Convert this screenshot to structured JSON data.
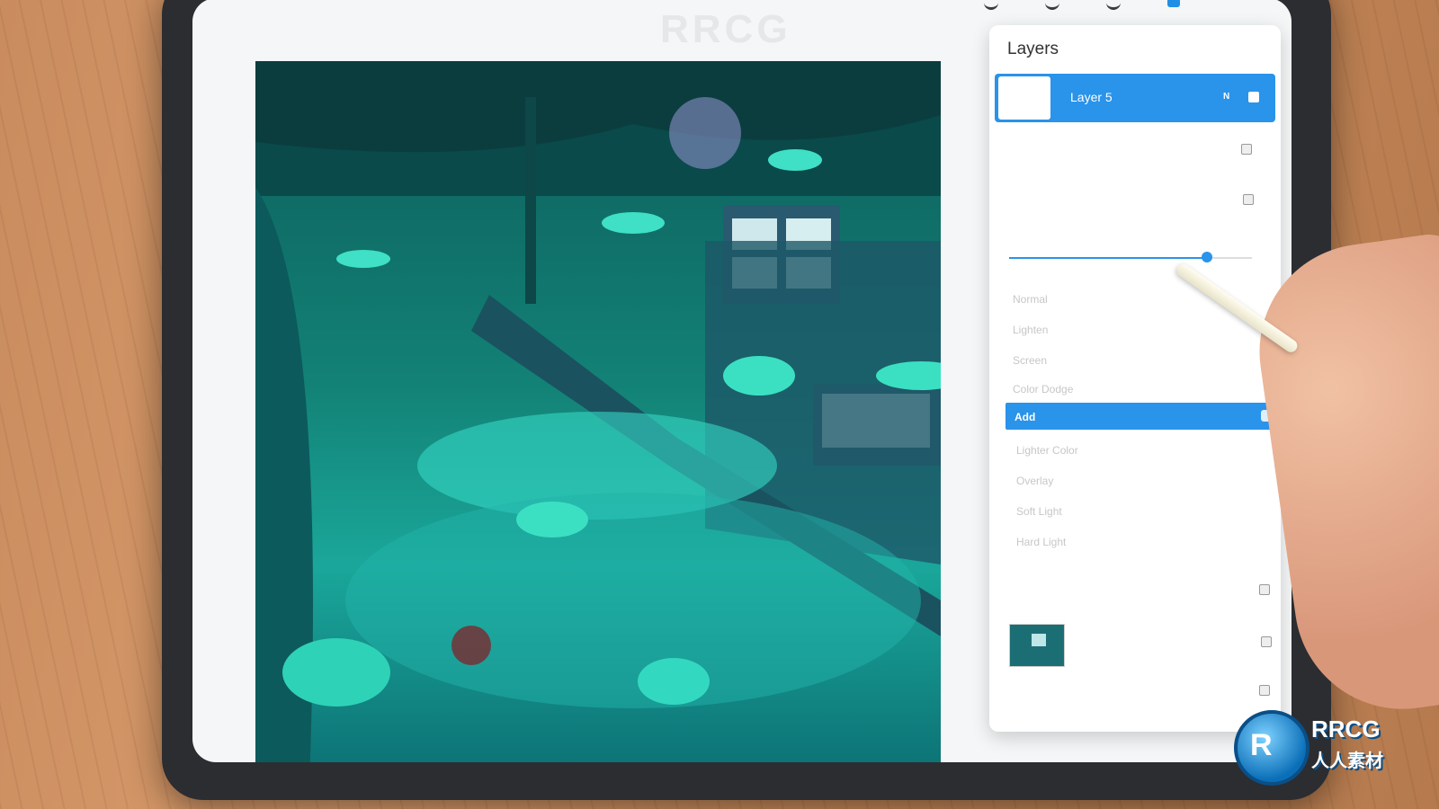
{
  "watermark": "RRCG",
  "layers_panel": {
    "title": "Layers",
    "active_layer": {
      "name": "Layer 5",
      "mode": "N"
    },
    "blend_modes": {
      "items": [
        "Normal",
        "Lighten",
        "Screen",
        "Color Dodge",
        "Add",
        "Lighter Color",
        "Overlay",
        "Soft Light",
        "Hard Light"
      ],
      "selected": "Add"
    }
  },
  "logo": {
    "brand": "RRCG",
    "brand_cn": "人人素材"
  },
  "colors": {
    "accent": "#2a93ea",
    "canvas_teal": "#138276"
  }
}
